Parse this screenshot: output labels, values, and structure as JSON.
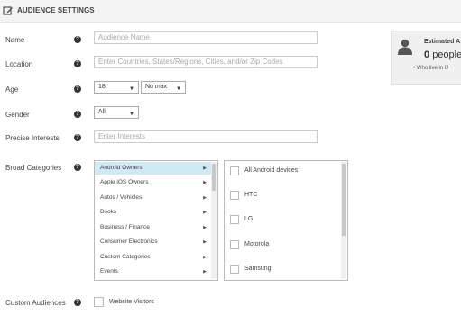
{
  "header": {
    "title": "AUDIENCE SETTINGS",
    "icon": "edit-icon"
  },
  "fields": {
    "name": {
      "label": "Name",
      "placeholder": "Audience Name"
    },
    "location": {
      "label": "Location",
      "placeholder": "Enter Countries, States/Regions, Cities, and/or Zip Codes"
    },
    "age": {
      "label": "Age",
      "min": "18",
      "max": "No max"
    },
    "gender": {
      "label": "Gender",
      "value": "All"
    },
    "interests": {
      "label": "Precise Interests",
      "placeholder": "Enter Interests"
    },
    "broad": {
      "label": "Broad Categories"
    },
    "custom": {
      "label": "Custom Audiences",
      "option": "Website Visitors"
    }
  },
  "help_glyph": "?",
  "caret_glyph": "▼",
  "arrow_glyph": "▶",
  "categories": [
    "Android Owners",
    "Apple iOS Owners",
    "Autos / Vehicles",
    "Books",
    "Business / Finance",
    "Consumer Electronics",
    "Custom Categories",
    "Events"
  ],
  "selected_category": "Android Owners",
  "options": [
    "All Android devices",
    "HTC",
    "LG",
    "Motorola",
    "Samsung"
  ],
  "estimate": {
    "title": "Estimated A",
    "count": "0",
    "unit": "people",
    "bullet": "Who live in U"
  },
  "colors": {
    "selected_bg": "#cfe9f5",
    "header_bg": "#f4f4f4",
    "estimate_bg": "#f0f0f0"
  }
}
